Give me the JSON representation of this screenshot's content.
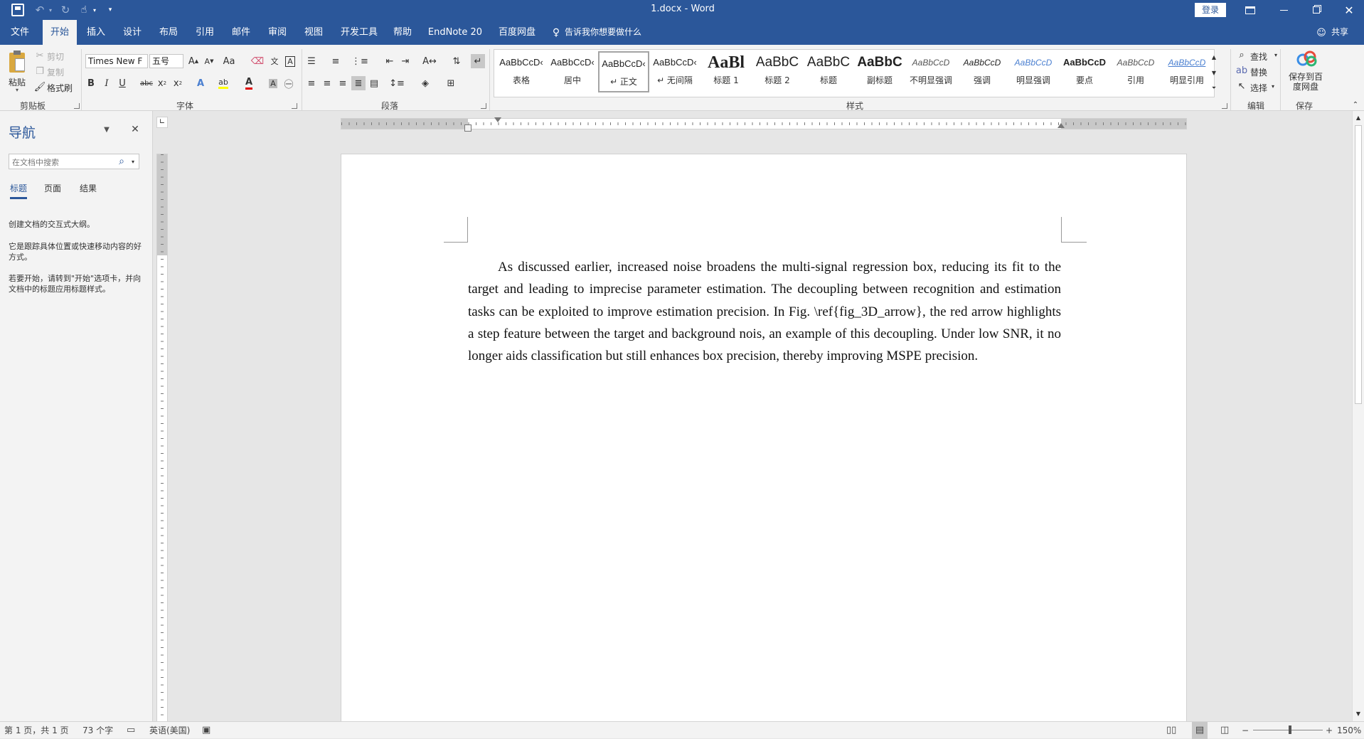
{
  "titlebar": {
    "title": "1.docx  -  Word",
    "login": "登录"
  },
  "tabs": [
    "文件",
    "开始",
    "插入",
    "设计",
    "布局",
    "引用",
    "邮件",
    "审阅",
    "视图",
    "开发工具",
    "帮助",
    "EndNote 20",
    "百度网盘"
  ],
  "tell_me": "告诉我你想要做什么",
  "share": "共享",
  "clipboard": {
    "paste": "粘贴",
    "cut": "剪切",
    "copy": "复制",
    "format_painter": "格式刷",
    "label": "剪贴板"
  },
  "font": {
    "name": "Times New F",
    "size": "五号",
    "label": "字体"
  },
  "paragraph": {
    "label": "段落"
  },
  "styles": {
    "label": "样式",
    "items": [
      {
        "preview": "AaBbCcD‹",
        "label": "表格"
      },
      {
        "preview": "AaBbCcD‹",
        "label": "居中"
      },
      {
        "preview": "AaBbCcD‹",
        "label": "↵ 正文"
      },
      {
        "preview": "AaBbCcD‹",
        "label": "↵ 无间隔"
      },
      {
        "preview": "AaBl",
        "label": "标题 1"
      },
      {
        "preview": "AaBbC",
        "label": "标题 2"
      },
      {
        "preview": "AaBbC",
        "label": "标题"
      },
      {
        "preview": "AaBbC",
        "label": "副标题"
      },
      {
        "preview": "AaBbCcD",
        "label": "不明显强调"
      },
      {
        "preview": "AaBbCcD",
        "label": "强调"
      },
      {
        "preview": "AaBbCcD",
        "label": "明显强调"
      },
      {
        "preview": "AaBbCcD",
        "label": "要点"
      },
      {
        "preview": "AaBbCcD",
        "label": "引用"
      },
      {
        "preview": "AaBbCcD",
        "label": "明显引用"
      }
    ]
  },
  "editing": {
    "find": "查找",
    "replace": "替换",
    "select": "选择",
    "label": "编辑"
  },
  "save_group": {
    "button": "保存到百度网盘",
    "label": "保存"
  },
  "nav": {
    "title": "导航",
    "search_placeholder": "在文档中搜索",
    "tabs": [
      "标题",
      "页面",
      "结果"
    ],
    "text1": "创建文档的交互式大纲。",
    "text2": "它是跟踪具体位置或快速移动内容的好方式。",
    "text3": "若要开始，请转到\"开始\"选项卡，并向文档中的标题应用标题样式。"
  },
  "document": {
    "paragraph": "As discussed earlier, increased noise broadens the multi-signal regression box, reducing its fit to the target and leading to imprecise parameter estimation. The decoupling between recognition and estimation tasks can be exploited to improve estimation precision. In Fig. \\ref{fig_3D_arrow}, the red arrow highlights a step feature between the target and background nois, an example of this decoupling. Under low SNR, it no longer aids classification but still enhances box precision, thereby improving MSPE precision."
  },
  "status": {
    "page": "第 1 页，共 1 页",
    "words": "73 个字",
    "language": "英语(美国)",
    "zoom": "150%"
  },
  "colors": {
    "accent": "#2b579a",
    "highlight": "#ffff00",
    "font_color": "#e00000"
  }
}
